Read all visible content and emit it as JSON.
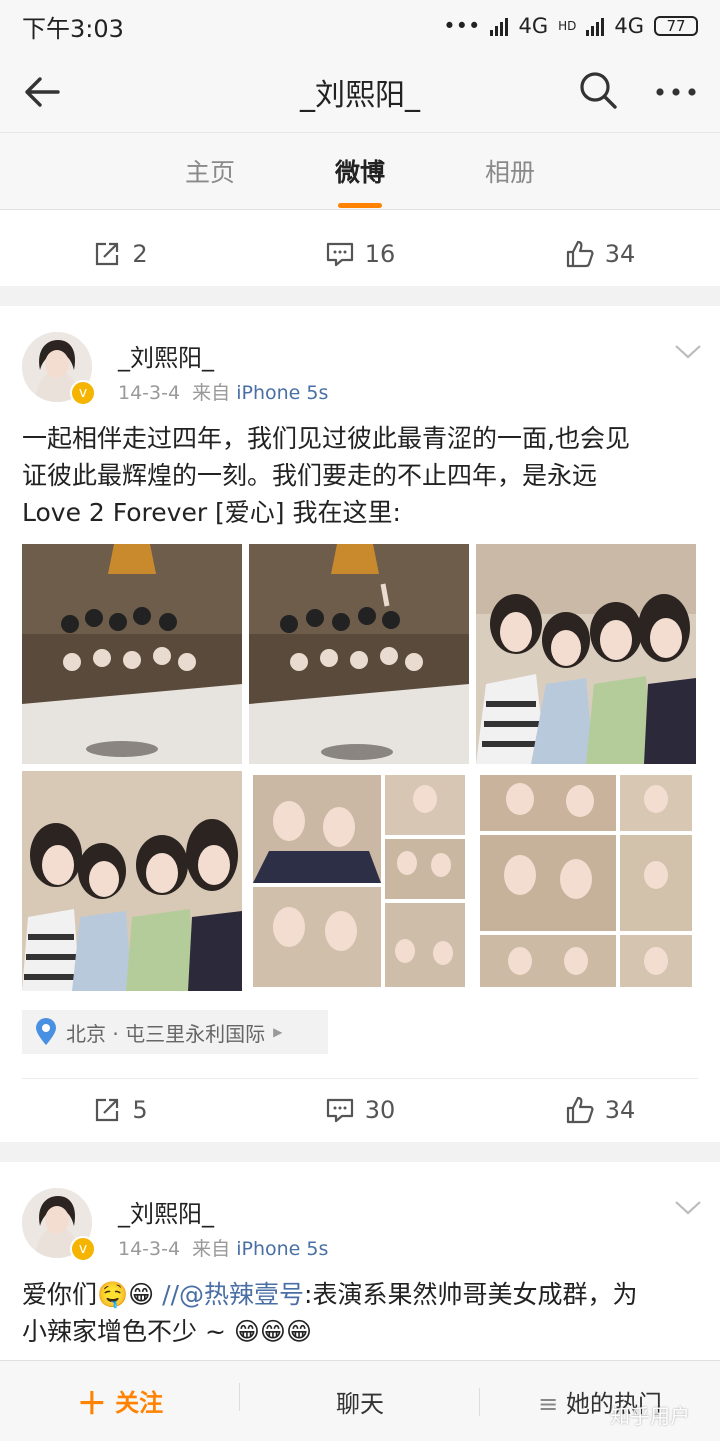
{
  "status_bar": {
    "time": "下午3:03",
    "dots": "•••",
    "net1": "4G",
    "hd": "HD",
    "net2": "4G",
    "battery": "77"
  },
  "header": {
    "title": "_刘熙阳_"
  },
  "tabs": [
    {
      "label": "主页"
    },
    {
      "label": "微博"
    },
    {
      "label": "相册"
    }
  ],
  "active_tab": "微博",
  "top_actions": {
    "repost": "2",
    "comment": "16",
    "like": "34"
  },
  "post1": {
    "user": "_刘熙阳_",
    "date": "14-3-4",
    "from_label": "来自",
    "source": "iPhone 5s",
    "text_lines": [
      "一起相伴走过四年，我们见过彼此最青涩的一面,也会见",
      "证彼此最辉煌的一刻。我们要走的不止四年，是永远",
      "Love 2 Forever  [爱心] 我在这里:"
    ],
    "location": "北京 · 屯三里永利国际",
    "actions": {
      "repost": "5",
      "comment": "30",
      "like": "34"
    }
  },
  "post2": {
    "user": "_刘熙阳_",
    "date": "14-3-4",
    "from_label": "来自",
    "source": "iPhone 5s",
    "text_prefix": "爱你们",
    "text_mention": "//@热辣壹号",
    "text_rest": ":表演系果然帅哥美女成群，为",
    "text_line2": "小辣家增色不少 ~"
  },
  "bottom_bar": {
    "follow": "关注",
    "chat": "聊天",
    "hot": "她的热门"
  },
  "watermark": "知乎用户",
  "colors": {
    "accent": "#ff8200",
    "link": "#4a6fa5",
    "badge": "#f5b400"
  }
}
